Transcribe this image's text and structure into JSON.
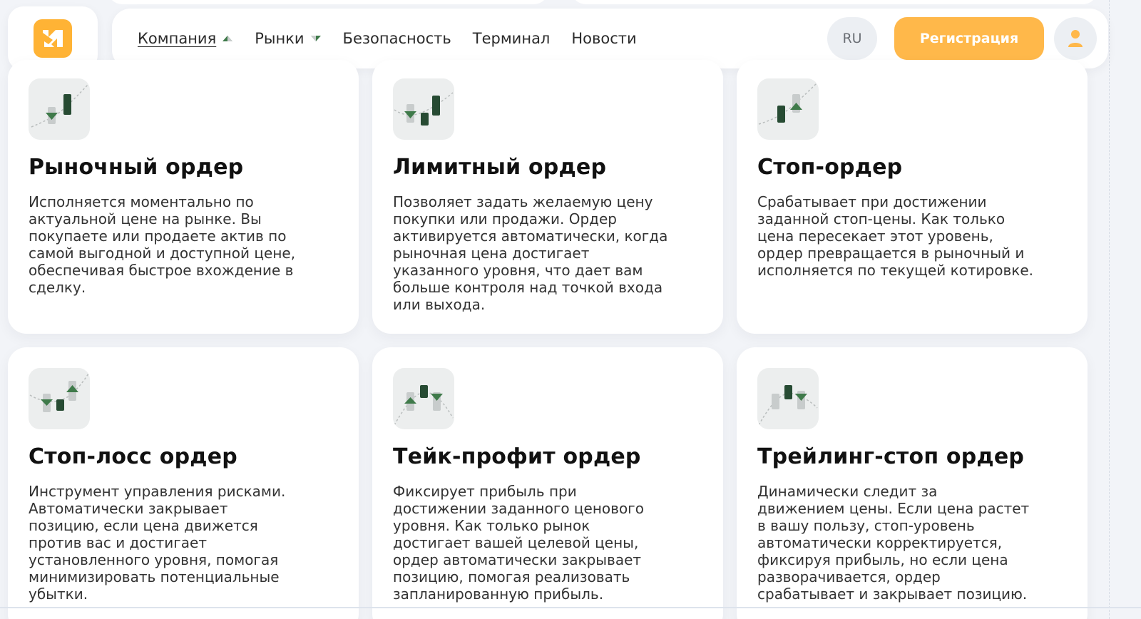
{
  "nav": {
    "items": [
      {
        "label": "Компания",
        "caret": "up"
      },
      {
        "label": "Рынки",
        "caret": "down"
      },
      {
        "label": "Безопасность"
      },
      {
        "label": "Терминал"
      },
      {
        "label": "Новости"
      }
    ],
    "lang": "RU",
    "register": "Регистрация"
  },
  "colors": {
    "accent": "#ffb84a",
    "logo": "#ffb335",
    "candle_dark": "#274b33",
    "candle_light": "#c8cccc",
    "triangle": "#3f7a4a"
  },
  "cards": [
    {
      "title": "Рыночный ордер",
      "lines": [
        "Исполняется моментально по",
        "актуальной цене на рынке. Вы",
        "покупаете или продаете актив по",
        "самой выгодной и доступной цене,",
        "обеспечивая быстрое вхождение в",
        "сделку."
      ]
    },
    {
      "title": "Лимитный ордер",
      "lines": [
        "Позволяет задать желаемую цену",
        "покупки или продажи. Ордер",
        "активируется автоматически, когда",
        "рыночная цена достигает",
        "указанного уровня, что дает вам",
        "больше контроля над точкой входа",
        "или выхода."
      ]
    },
    {
      "title": "Стоп-ордер",
      "lines": [
        "Срабатывает при достижении",
        "заданной стоп-цены. Как только",
        "цена пересекает этот уровень,",
        "ордер превращается в рыночный и",
        "исполняется по текущей котировке."
      ]
    },
    {
      "title": "Стоп-лосс ордер",
      "lines": [
        "Инструмент управления рисками.",
        "Автоматически закрывает",
        "позицию, если цена движется",
        "против вас и достигает",
        "установленного уровня, помогая",
        "минимизировать потенциальные",
        "убытки."
      ]
    },
    {
      "title": "Тейк-профит ордер",
      "lines": [
        "Фиксирует прибыль при",
        "достижении заданного ценового",
        "уровня. Как только рынок",
        "достигает вашей целевой цены,",
        "ордер автоматически закрывает",
        "позицию, помогая реализовать",
        "запланированную прибыль."
      ]
    },
    {
      "title": "Трейлинг-стоп ордер",
      "lines": [
        "Динамически следит за",
        "движением цены. Если цена растет",
        "в вашу пользу, стоп-уровень",
        "автоматически корректируется,",
        "фиксируя прибыль, но если цена",
        "разворачивается, ордер",
        "срабатывает и закрывает позицию."
      ]
    }
  ]
}
